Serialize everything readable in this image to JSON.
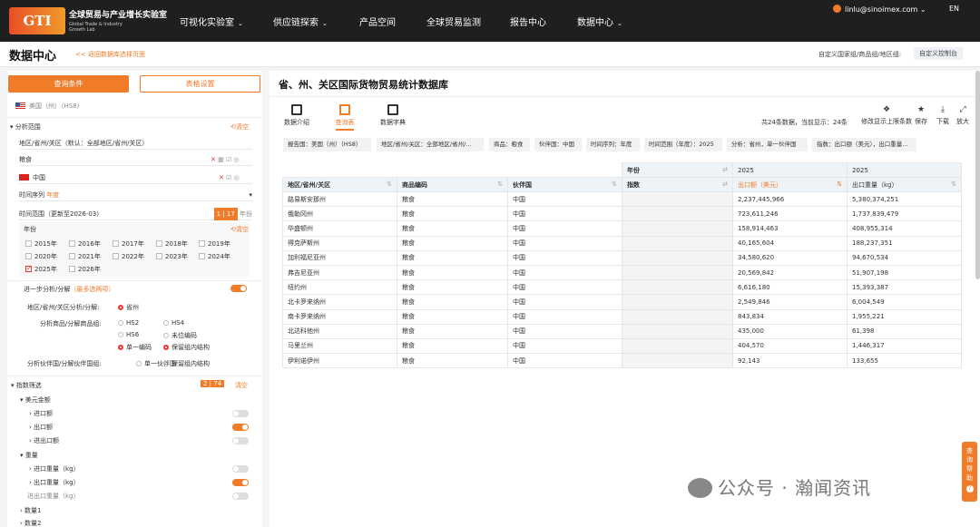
{
  "brand": {
    "mark": "GTI",
    "cn": "全球贸易与产业增长实验室",
    "en1": "Global Trade & Industry",
    "en2": "Growth Lab"
  },
  "nav": [
    "可视化实验室",
    "供应链探索",
    "产品空间",
    "全球贸易监测",
    "报告中心",
    "数据中心"
  ],
  "user": "linlu@sinoimex.com",
  "lang": "EN",
  "page": {
    "title": "数据中心",
    "back": "<< 返回数据库选择页面",
    "custom_label": "自定义国家组/商品组/地区组:",
    "custom_btn": "自定义控制台"
  },
  "left": {
    "query_btn": "查询条件",
    "table_btn": "表格设置",
    "reporter": "美国（州）（HS8）",
    "range_title": "分析范围",
    "clear": "清空",
    "region": "地区/省州/关区（默认：全部地区/省州/关区）",
    "product": "粮食",
    "partner": "中国",
    "series_label": "时间序列",
    "series_val": "年度",
    "time_label": "时间范围（更新至2026-03）",
    "time_count": "1 | 17",
    "time_unit": "年份",
    "year_title": "年份",
    "years": [
      "2015年",
      "2016年",
      "2017年",
      "2018年",
      "2019年",
      "2020年",
      "2021年",
      "2022年",
      "2023年",
      "2024年",
      "2025年",
      "2026年"
    ],
    "further": "进一步分析/分解",
    "further_note": "（最多选两项）",
    "region_an": "地区/省州/关区分析/分解:",
    "region_opt": "省州",
    "prod_an": "分析商品/分解商品组:",
    "hs2": "HS2",
    "hs4": "HS4",
    "hs6": "HS6",
    "unk": "未位编码",
    "single": "单一编码",
    "keep": "保留组内结构",
    "partner_an": "分析伙伴国/分解伙伴国组:",
    "single_p": "单一伙伴国",
    "keep_p": "保留组内结构",
    "idx_title": "指数筛选",
    "idx_count": "2 | 74",
    "usd": "美元金额",
    "imp": "进口额",
    "exp": "出口额",
    "tot": "进出口额",
    "wt": "重量",
    "imp_w": "进口重量（kg）",
    "exp_w": "出口重量（kg）",
    "tot_w": "进出口重量（kg）",
    "q1": "数量1",
    "q2": "数量2"
  },
  "main": {
    "title": "省、州、关区国际货物贸易统计数据库",
    "tools": [
      "数据介绍",
      "查询表",
      "数据字典"
    ],
    "stat": "共24条数据，当前显示：24条",
    "actions": [
      "修改显示上限条数",
      "保存",
      "下载",
      "放大"
    ],
    "chips": [
      "报告国：美国（州）（HS8）",
      "地区/省州/关区：全部地区/省州/...",
      "商品：粮食",
      "伙伴国：中国",
      "时间序列：年度",
      "时间范围（年度）：2025",
      "分析：省州，单一伙伴国",
      "指数：出口额（美元），出口重量..."
    ],
    "headers": [
      "地区/省州/关区",
      "商品编码",
      "伙伴国",
      "年份",
      "指数",
      "2025",
      "2025",
      "出口额（美元）",
      "出口重量（kg）"
    ],
    "rows": [
      [
        "路易斯安那州",
        "粮食",
        "中国",
        "2,237,445,966",
        "5,380,374,251"
      ],
      [
        "俄勒冈州",
        "粮食",
        "中国",
        "723,611,246",
        "1,737,839,479"
      ],
      [
        "华盛顿州",
        "粮食",
        "中国",
        "158,914,463",
        "408,955,314"
      ],
      [
        "得克萨斯州",
        "粮食",
        "中国",
        "40,165,604",
        "188,237,351"
      ],
      [
        "加利福尼亚州",
        "粮食",
        "中国",
        "34,580,620",
        "94,670,534"
      ],
      [
        "弗吉尼亚州",
        "粮食",
        "中国",
        "20,569,842",
        "51,907,198"
      ],
      [
        "纽约州",
        "粮食",
        "中国",
        "6,616,180",
        "15,393,387"
      ],
      [
        "北卡罗来纳州",
        "粮食",
        "中国",
        "2,549,846",
        "6,004,549"
      ],
      [
        "南卡罗来纳州",
        "粮食",
        "中国",
        "843,834",
        "1,955,221"
      ],
      [
        "北达科他州",
        "粮食",
        "中国",
        "435,000",
        "61,398"
      ],
      [
        "马里兰州",
        "粮食",
        "中国",
        "404,570",
        "1,446,317"
      ],
      [
        "伊利诺伊州",
        "粮食",
        "中国",
        "92,143",
        "133,655"
      ]
    ]
  },
  "help": "查询帮助",
  "watermark": "公众号 · 瀚闻资讯"
}
